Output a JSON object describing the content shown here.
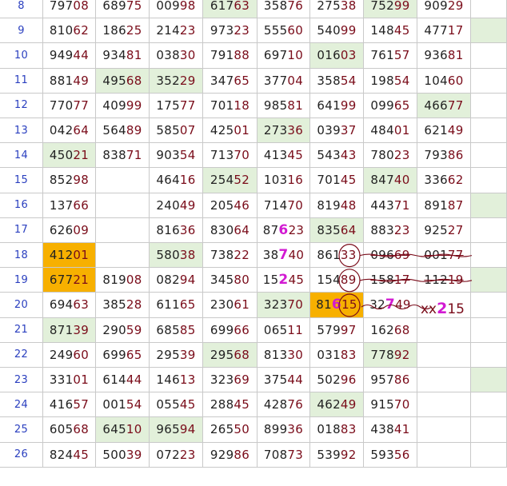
{
  "rows": [
    {
      "label": "8",
      "cells": [
        [
          "797",
          "08"
        ],
        [
          "689",
          "75"
        ],
        [
          "009",
          "98"
        ],
        [
          "617",
          "63"
        ],
        [
          "358",
          "76"
        ],
        [
          "275",
          "38"
        ],
        [
          "752",
          "99"
        ],
        [
          "909",
          "29"
        ],
        null
      ]
    },
    {
      "label": "9",
      "cells": [
        [
          "810",
          "62"
        ],
        [
          "186",
          "25"
        ],
        [
          "214",
          "23"
        ],
        [
          "973",
          "23"
        ],
        [
          "555",
          "60"
        ],
        [
          "540",
          "99"
        ],
        [
          "148",
          "45"
        ],
        [
          "477",
          "17"
        ],
        null
      ]
    },
    {
      "label": "10",
      "cells": [
        [
          "949",
          "44"
        ],
        [
          "934",
          "81"
        ],
        [
          "038",
          "30"
        ],
        [
          "791",
          "88"
        ],
        [
          "697",
          "10"
        ],
        [
          "016",
          "03"
        ],
        [
          "761",
          "57"
        ],
        [
          "936",
          "81"
        ],
        null
      ]
    },
    {
      "label": "11",
      "cells": [
        [
          "881",
          "49"
        ],
        [
          "495",
          "68"
        ],
        [
          "352",
          "29"
        ],
        [
          "347",
          "65"
        ],
        [
          "377",
          "04"
        ],
        [
          "358",
          "54"
        ],
        [
          "198",
          "54"
        ],
        [
          "104",
          "60"
        ],
        null
      ]
    },
    {
      "label": "12",
      "cells": [
        [
          "770",
          "77"
        ],
        [
          "409",
          "99"
        ],
        [
          "175",
          "77"
        ],
        [
          "701",
          "18"
        ],
        [
          "985",
          "81"
        ],
        [
          "641",
          "99"
        ],
        [
          "099",
          "65"
        ],
        [
          "466",
          "77"
        ],
        null
      ]
    },
    {
      "label": "13",
      "cells": [
        [
          "042",
          "64"
        ],
        [
          "564",
          "89"
        ],
        [
          "585",
          "07"
        ],
        [
          "425",
          "01"
        ],
        [
          "273",
          "36"
        ],
        [
          "039",
          "37"
        ],
        [
          "484",
          "01"
        ],
        [
          "621",
          "49"
        ],
        null
      ]
    },
    {
      "label": "14",
      "cells": [
        [
          "450",
          "21"
        ],
        [
          "838",
          "71"
        ],
        [
          "903",
          "54"
        ],
        [
          "713",
          "70"
        ],
        [
          "413",
          "45"
        ],
        [
          "543",
          "43"
        ],
        [
          "780",
          "23"
        ],
        [
          "793",
          "86"
        ],
        null
      ]
    },
    {
      "label": "15",
      "cells": [
        [
          "852",
          "98"
        ],
        null,
        [
          "464",
          "16"
        ],
        [
          "254",
          "52"
        ],
        [
          "103",
          "16"
        ],
        [
          "701",
          "45"
        ],
        [
          "847",
          "40"
        ],
        [
          "336",
          "62"
        ],
        null
      ]
    },
    {
      "label": "16",
      "cells": [
        [
          "137",
          "66"
        ],
        null,
        [
          "240",
          "49"
        ],
        [
          "205",
          "46"
        ],
        [
          "714",
          "70"
        ],
        [
          "819",
          "48"
        ],
        [
          "443",
          "71"
        ],
        [
          "891",
          "87"
        ],
        null
      ]
    },
    {
      "label": "17",
      "cells": [
        [
          "626",
          "09"
        ],
        null,
        [
          "816",
          "36"
        ],
        [
          "830",
          "64"
        ],
        [
          "876",
          "23"
        ],
        [
          "835",
          "64"
        ],
        [
          "883",
          "23"
        ],
        [
          "925",
          "27"
        ],
        null
      ]
    },
    {
      "label": "18",
      "cells": [
        [
          "412",
          "01"
        ],
        null,
        [
          "580",
          "38"
        ],
        [
          "738",
          "22"
        ],
        [
          "387",
          "40"
        ],
        [
          "861",
          "33"
        ],
        [
          "096",
          "69"
        ],
        [
          "001",
          "77"
        ],
        null
      ]
    },
    {
      "label": "19",
      "cells": [
        [
          "677",
          "21"
        ],
        [
          "819",
          "08"
        ],
        [
          "082",
          "94"
        ],
        [
          "345",
          "80"
        ],
        [
          "152",
          "45"
        ],
        [
          "154",
          "89"
        ],
        [
          "158",
          "17"
        ],
        [
          "112",
          "19"
        ],
        null
      ]
    },
    {
      "label": "20",
      "cells": [
        [
          "694",
          "63"
        ],
        [
          "385",
          "28"
        ],
        [
          "611",
          "65"
        ],
        [
          "230",
          "61"
        ],
        [
          "323",
          "70"
        ],
        [
          "816",
          "15"
        ],
        [
          "327",
          "49"
        ],
        null,
        null
      ]
    },
    {
      "label": "21",
      "cells": [
        [
          "871",
          "39"
        ],
        [
          "290",
          "59"
        ],
        [
          "685",
          "85"
        ],
        [
          "699",
          "66"
        ],
        [
          "065",
          "11"
        ],
        [
          "579",
          "97"
        ],
        [
          "162",
          "68"
        ],
        null,
        null
      ]
    },
    {
      "label": "22",
      "cells": [
        [
          "249",
          "60"
        ],
        [
          "699",
          "65"
        ],
        [
          "295",
          "39"
        ],
        [
          "295",
          "68"
        ],
        [
          "813",
          "30"
        ],
        [
          "031",
          "83"
        ],
        [
          "778",
          "92"
        ],
        null,
        null
      ]
    },
    {
      "label": "23",
      "cells": [
        [
          "331",
          "01"
        ],
        [
          "614",
          "44"
        ],
        [
          "146",
          "13"
        ],
        [
          "323",
          "69"
        ],
        [
          "375",
          "44"
        ],
        [
          "502",
          "96"
        ],
        [
          "957",
          "86"
        ],
        null,
        null
      ]
    },
    {
      "label": "24",
      "cells": [
        [
          "416",
          "57"
        ],
        [
          "001",
          "54"
        ],
        [
          "055",
          "45"
        ],
        [
          "288",
          "45"
        ],
        [
          "428",
          "76"
        ],
        [
          "462",
          "49"
        ],
        [
          "915",
          "70"
        ],
        null,
        null
      ]
    },
    {
      "label": "25",
      "cells": [
        [
          "605",
          "68"
        ],
        [
          "645",
          "10"
        ],
        [
          "965",
          "94"
        ],
        [
          "265",
          "50"
        ],
        [
          "899",
          "36"
        ],
        [
          "018",
          "83"
        ],
        [
          "438",
          "41"
        ],
        null,
        null
      ]
    },
    {
      "label": "26",
      "cells": [
        [
          "824",
          "45"
        ],
        [
          "500",
          "39"
        ],
        [
          "072",
          "23"
        ],
        [
          "929",
          "86"
        ],
        [
          "708",
          "73"
        ],
        [
          "539",
          "92"
        ],
        [
          "593",
          "56"
        ],
        null,
        null
      ]
    }
  ],
  "highlights": {
    "colors": {
      "green": "#e2f0da",
      "orange": "#f7b000",
      "magenta": "#d21ad2",
      "maroon": "#7a0c1a",
      "rowLabel": "#2a3fbf"
    },
    "cells": [
      {
        "row": 0,
        "col": 4,
        "type": "green"
      },
      {
        "row": 0,
        "col": 7,
        "type": "green"
      },
      {
        "row": 1,
        "col": 9,
        "type": "green"
      },
      {
        "row": 2,
        "col": 6,
        "type": "green"
      },
      {
        "row": 3,
        "col": 2,
        "type": "green"
      },
      {
        "row": 3,
        "col": 3,
        "type": "green"
      },
      {
        "row": 4,
        "col": 8,
        "type": "green"
      },
      {
        "row": 5,
        "col": 5,
        "type": "green"
      },
      {
        "row": 6,
        "col": 1,
        "type": "green"
      },
      {
        "row": 7,
        "col": 4,
        "type": "green"
      },
      {
        "row": 7,
        "col": 7,
        "type": "green"
      },
      {
        "row": 8,
        "col": 9,
        "type": "green"
      },
      {
        "row": 9,
        "col": 6,
        "type": "green"
      },
      {
        "row": 10,
        "col": 1,
        "type": "orange"
      },
      {
        "row": 10,
        "col": 3,
        "type": "green"
      },
      {
        "row": 11,
        "col": 1,
        "type": "orange"
      },
      {
        "row": 11,
        "col": 9,
        "type": "green"
      },
      {
        "row": 12,
        "col": 5,
        "type": "green"
      },
      {
        "row": 12,
        "col": 6,
        "type": "orange"
      },
      {
        "row": 13,
        "col": 1,
        "type": "green"
      },
      {
        "row": 14,
        "col": 4,
        "type": "green"
      },
      {
        "row": 14,
        "col": 7,
        "type": "green"
      },
      {
        "row": 15,
        "col": 9,
        "type": "green"
      },
      {
        "row": 16,
        "col": 6,
        "type": "green"
      },
      {
        "row": 17,
        "col": 2,
        "type": "green"
      },
      {
        "row": 17,
        "col": 3,
        "type": "green"
      }
    ],
    "magentaDigits": [
      {
        "row": 9,
        "col": 5,
        "index": 2
      },
      {
        "row": 10,
        "col": 5,
        "index": 2
      },
      {
        "row": 11,
        "col": 5,
        "index": 2
      },
      {
        "row": 12,
        "col": 6,
        "index": 2
      },
      {
        "row": 12,
        "col": 7,
        "index": 2
      }
    ],
    "struck": [
      {
        "row": 10,
        "col": 7
      },
      {
        "row": 10,
        "col": 8
      },
      {
        "row": 11,
        "col": 7
      },
      {
        "row": 11,
        "col": 8
      }
    ]
  },
  "annotation": {
    "prefix": "xx",
    "magenta": "2",
    "suffix": "15"
  }
}
